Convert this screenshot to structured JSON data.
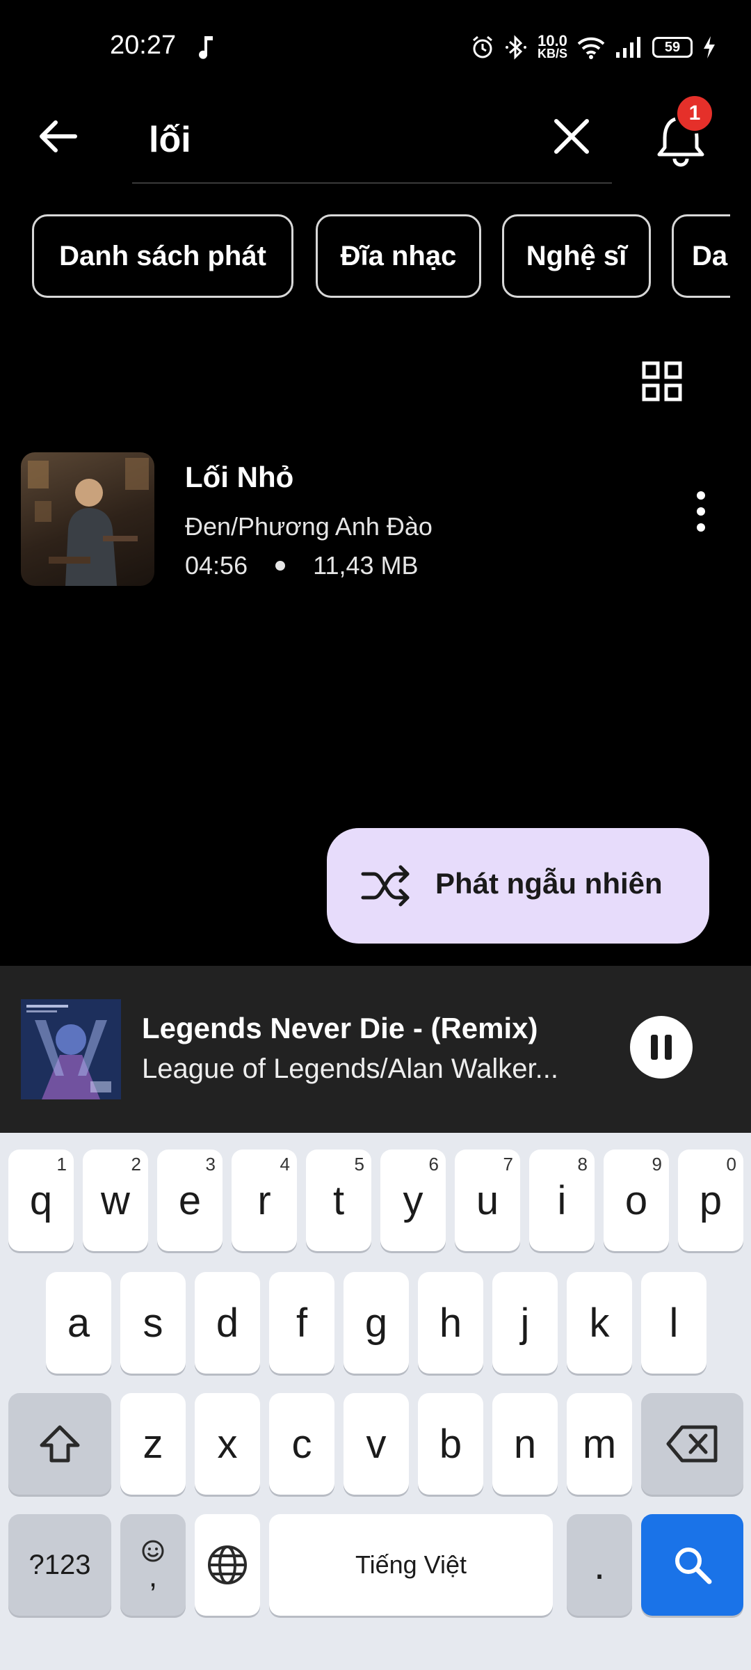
{
  "status_bar": {
    "time": "20:27",
    "net_speed_value": "10.0",
    "net_speed_unit": "KB/S",
    "battery": "59"
  },
  "search": {
    "query": "lối",
    "notification_count": "1"
  },
  "filters": [
    "Danh sách phát",
    "Đĩa nhạc",
    "Nghệ sĩ",
    "Da"
  ],
  "song": {
    "title": "Lối Nhỏ",
    "artist": "Đen/Phương Anh Đào",
    "duration": "04:56",
    "size": "11,43 MB"
  },
  "shuffle_label": "Phát ngẫu nhiên",
  "now_playing": {
    "title": "Legends Never Die - (Remix)",
    "artist": "League of Legends/Alan Walker..."
  },
  "keyboard": {
    "row1": [
      {
        "k": "q",
        "h": "1"
      },
      {
        "k": "w",
        "h": "2"
      },
      {
        "k": "e",
        "h": "3"
      },
      {
        "k": "r",
        "h": "4"
      },
      {
        "k": "t",
        "h": "5"
      },
      {
        "k": "y",
        "h": "6"
      },
      {
        "k": "u",
        "h": "7"
      },
      {
        "k": "i",
        "h": "8"
      },
      {
        "k": "o",
        "h": "9"
      },
      {
        "k": "p",
        "h": "0"
      }
    ],
    "row2": [
      "a",
      "s",
      "d",
      "f",
      "g",
      "h",
      "j",
      "k",
      "l"
    ],
    "row3": [
      "z",
      "x",
      "c",
      "v",
      "b",
      "n",
      "m"
    ],
    "symbols_label": "?123",
    "emoji_comma": ",",
    "space_label": "Tiếng Việt",
    "period": "."
  },
  "colors": {
    "background": "#000000",
    "player_bg": "#222222",
    "shuffle_bg": "#e7dcfb",
    "badge": "#e5302a",
    "search_key": "#1a73e8",
    "keyboard_bg": "#e6e9ef"
  },
  "icons": [
    "music-note-icon",
    "alarm-icon",
    "bluetooth-icon",
    "wifi-icon",
    "signal-icon",
    "charging-icon",
    "back-arrow-icon",
    "close-icon",
    "bell-icon",
    "grid-view-icon",
    "more-vert-icon",
    "shuffle-icon",
    "pause-icon",
    "shift-icon",
    "backspace-icon",
    "emoji-icon",
    "globe-icon",
    "search-icon"
  ]
}
